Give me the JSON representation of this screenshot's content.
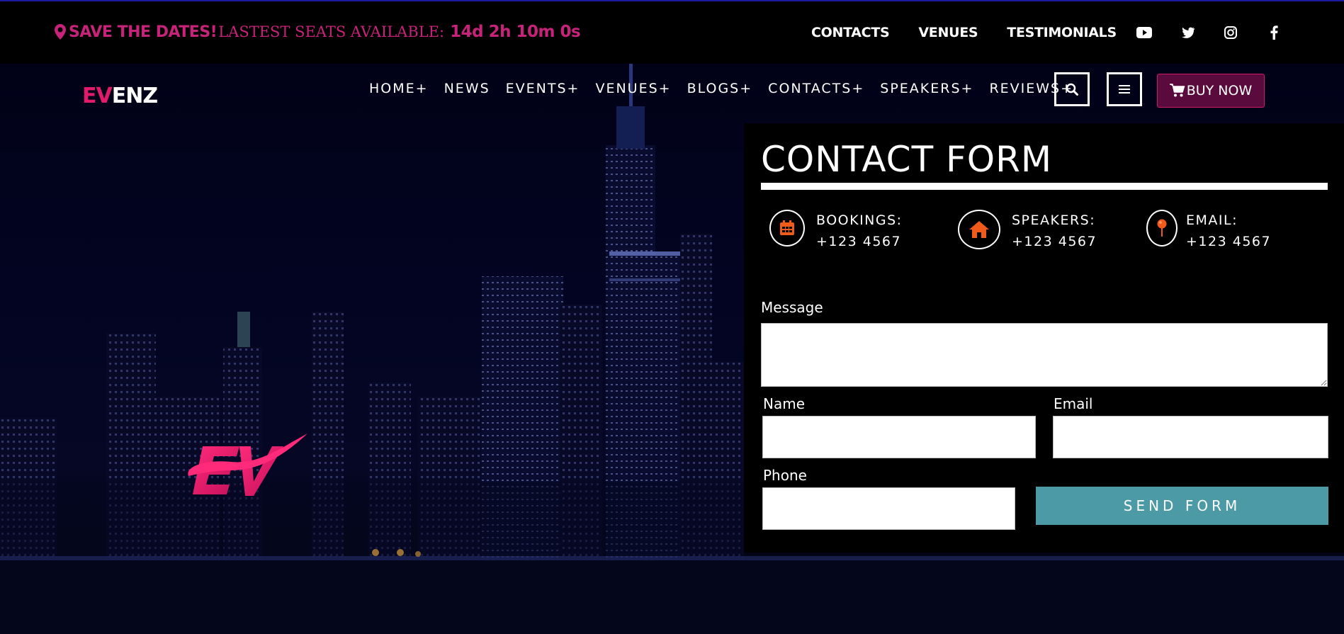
{
  "topbar": {
    "save_text": "SAVE THE DATES!",
    "seats_text": "LASTEST SEATS AVAILABLE:",
    "countdown": "14d 2h 10m 0s",
    "links": [
      "CONTACTS",
      "VENUES",
      "TESTIMONIALS"
    ],
    "social_icons": [
      "youtube-icon",
      "twitter-icon",
      "instagram-icon",
      "facebook-icon"
    ]
  },
  "header": {
    "logo_ev": "EV",
    "logo_rest": "ENZ",
    "nav": [
      "HOME+",
      "NEWS",
      "EVENTS+",
      "VENUES+",
      "BLOGS+",
      "CONTACTS+",
      "SPEAKERS+",
      "REVIEWS+"
    ],
    "buy_label": "BUY NOW"
  },
  "contact": {
    "title": "CONTACT FORM",
    "info": [
      {
        "label": "BOOKINGS:",
        "value": "+123 4567",
        "icon": "calendar-icon"
      },
      {
        "label": "SPEAKERS:",
        "value": "+123 4567",
        "icon": "home-icon"
      },
      {
        "label": "EMAIL:",
        "value": "+123 4567",
        "icon": "map-pin-icon"
      }
    ],
    "message_label": "Message",
    "name_label": "Name",
    "email_label": "Email",
    "phone_label": "Phone",
    "send_label": "SEND FORM"
  },
  "colors": {
    "accent": "#c8237a",
    "send": "#4b9aa6",
    "icon": "#f05a1a"
  }
}
